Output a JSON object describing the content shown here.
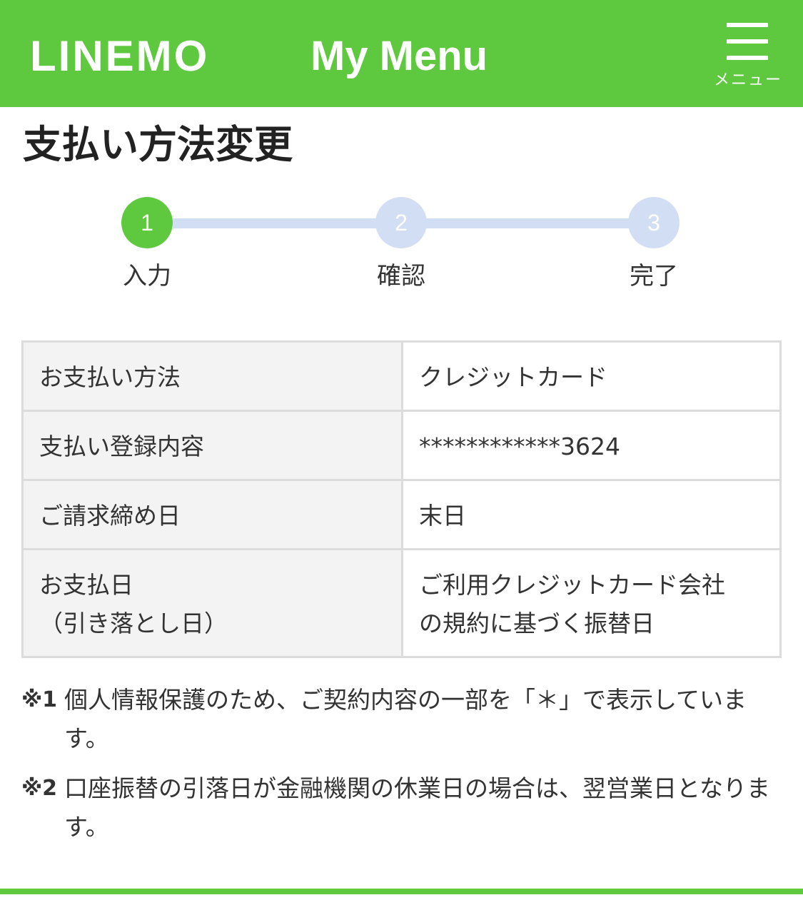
{
  "header": {
    "logo": "LINEMO",
    "title": "My Menu",
    "menu_label": "メニュー"
  },
  "page_title": "支払い方法変更",
  "steps": [
    {
      "number": "1",
      "label": "入力"
    },
    {
      "number": "2",
      "label": "確認"
    },
    {
      "number": "3",
      "label": "完了"
    }
  ],
  "table": {
    "rows": [
      {
        "label": "お支払い方法",
        "value": "クレジットカード"
      },
      {
        "label": "支払い登録内容",
        "value": "************3624"
      },
      {
        "label": "ご請求締め日",
        "value": "末日"
      },
      {
        "label_line1": "お支払日",
        "label_line2": "（引き落とし日）",
        "value_line1": "ご利用クレジットカード会社",
        "value_line2": "の規約に基づく振替日"
      }
    ]
  },
  "notes": [
    {
      "mark": "※1",
      "text": "個人情報保護のため、ご契約内容の一部を「＊」で表示しています。"
    },
    {
      "mark": "※2",
      "text": "口座振替の引落日が金融機関の休業日の場合は、翌営業日となります。"
    }
  ],
  "colors": {
    "brand_green": "#5ec83e",
    "step_inactive": "#d1def3",
    "table_border": "#dcdcdc",
    "table_header_bg": "#f3f3f3"
  }
}
